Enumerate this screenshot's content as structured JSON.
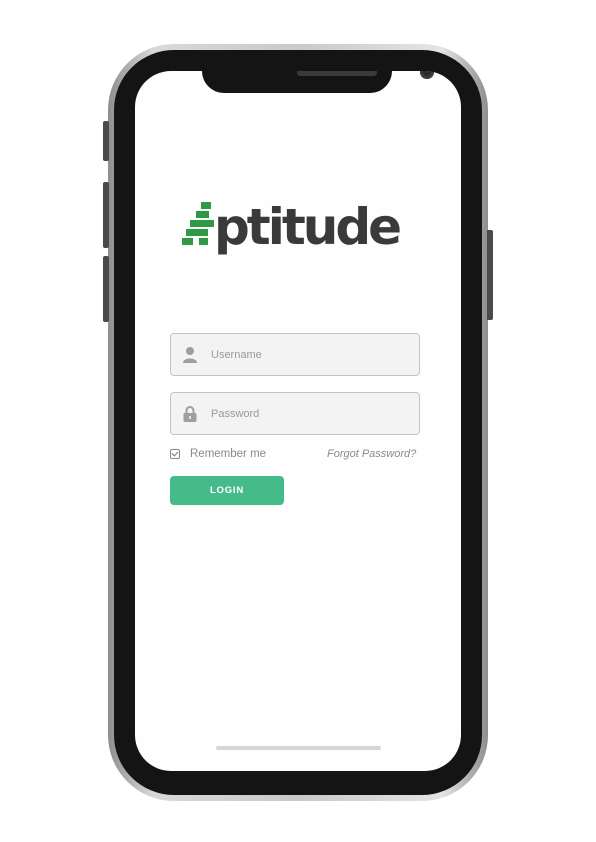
{
  "app": {
    "logo_text": "ptitude",
    "brand_color": "#2e9a46",
    "text_color": "#3a3a3a"
  },
  "login_form": {
    "username": {
      "value": "",
      "placeholder": "Username",
      "icon": "user-icon"
    },
    "password": {
      "value": "",
      "placeholder": "Password",
      "icon": "lock-icon"
    },
    "remember_me": {
      "label": "Remember me",
      "checked": true
    },
    "forgot_password_label": "Forgot Password?",
    "login_label": "LOGIN",
    "login_color": "#45bb8a"
  }
}
